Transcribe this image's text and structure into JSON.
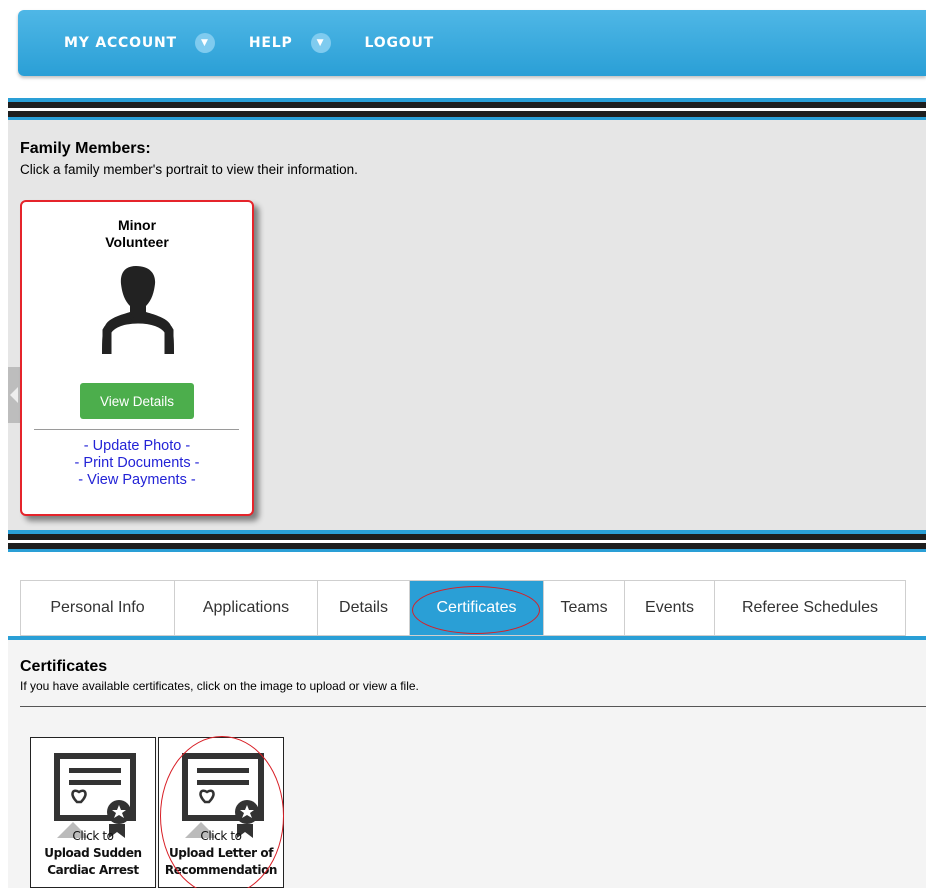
{
  "nav": {
    "items": [
      {
        "label": "MY ACCOUNT",
        "has_dropdown": true
      },
      {
        "label": "HELP",
        "has_dropdown": true
      },
      {
        "label": "LOGOUT",
        "has_dropdown": false
      }
    ]
  },
  "family": {
    "title": "Family Members:",
    "subtitle": "Click a family member's portrait to view their information.",
    "member": {
      "name_line1": "Minor",
      "name_line2": "Volunteer",
      "view_button": "View Details",
      "links": [
        "- Update Photo -",
        "- Print Documents -",
        "- View Payments -"
      ]
    }
  },
  "tabs": {
    "items": [
      "Personal Info",
      "Applications",
      "Details",
      "Certificates",
      "Teams",
      "Events",
      "Referee Schedules"
    ],
    "active": "Certificates"
  },
  "certificates": {
    "title": "Certificates",
    "subtitle": "If you have available certificates, click on the image to upload or view a file.",
    "cards": [
      {
        "line1": "Click to",
        "line2": "Upload Sudden",
        "line3": "Cardiac Arrest"
      },
      {
        "line1": "Click to",
        "line2": "Upload Letter of",
        "line3": "Recommendation"
      }
    ]
  },
  "colors": {
    "accent": "#2a9fd6",
    "button_green": "#4cae4c",
    "link_blue": "#2323d6",
    "highlight_red": "#d81f26"
  }
}
